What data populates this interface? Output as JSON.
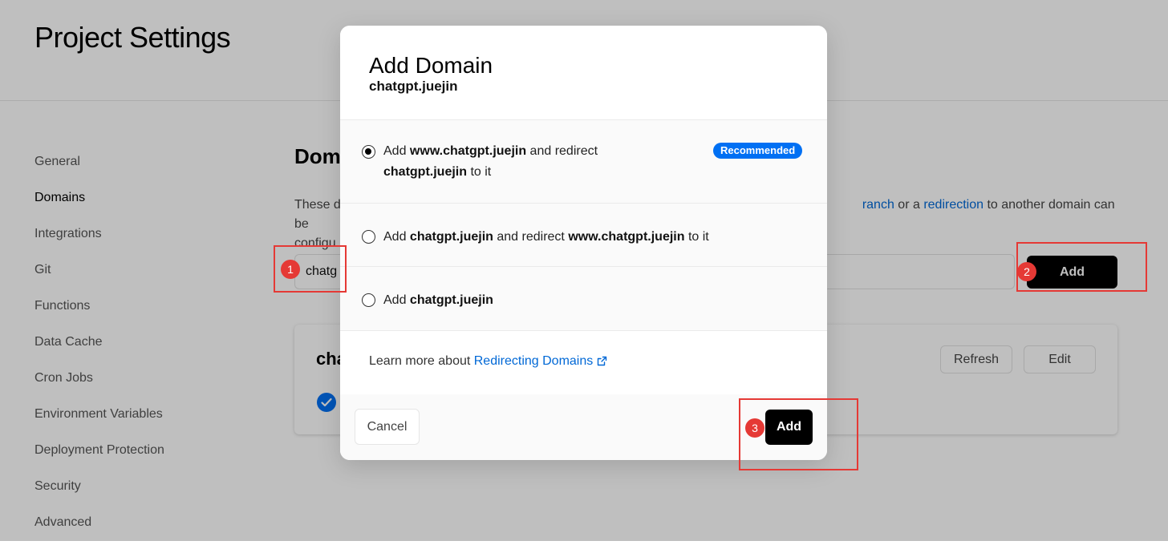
{
  "page": {
    "title": "Project Settings"
  },
  "sidebar": {
    "items": [
      {
        "label": "General"
      },
      {
        "label": "Domains"
      },
      {
        "label": "Integrations"
      },
      {
        "label": "Git"
      },
      {
        "label": "Functions"
      },
      {
        "label": "Data Cache"
      },
      {
        "label": "Cron Jobs"
      },
      {
        "label": "Environment Variables"
      },
      {
        "label": "Deployment Protection"
      },
      {
        "label": "Security"
      },
      {
        "label": "Advanced"
      }
    ]
  },
  "domains_section": {
    "title": "Dom",
    "desc_start": "These d",
    "link_branch": "ranch",
    "desc_or_a": " or a ",
    "link_redirection": "redirection",
    "desc_rest": " to another domain can be",
    "desc_line2": "configu",
    "input_value": "chatg",
    "add_label": "Add",
    "card": {
      "name": "cha",
      "refresh_label": "Refresh",
      "edit_label": "Edit"
    }
  },
  "modal": {
    "title": "Add Domain",
    "subtitle": "chatgpt.juejin",
    "options": [
      {
        "prefix": "Add ",
        "bold_1": "www.chatgpt.juejin",
        "middle": " and redirect ",
        "bold_2": "chatgpt.juejin",
        "suffix": " to it",
        "badge": "Recommended",
        "checked": true
      },
      {
        "prefix": "Add ",
        "bold_1": "chatgpt.juejin",
        "middle": " and redirect ",
        "bold_2": "www.chatgpt.juejin",
        "suffix": " to it",
        "checked": false
      },
      {
        "prefix": "Add ",
        "bold_1": "chatgpt.juejin",
        "checked": false
      }
    ],
    "learn_more_text": "Learn more about ",
    "learn_more_link": "Redirecting Domains",
    "cancel_label": "Cancel",
    "add_label": "Add"
  },
  "annotations": {
    "markers": [
      "1",
      "2",
      "3"
    ],
    "color": "#e53935"
  },
  "colors": {
    "accent": "#0070f3",
    "link": "#0068d6",
    "primary_button": "#000000"
  },
  "icons": {
    "selected_check": "check-circle-icon",
    "external_link": "external-link-icon"
  }
}
